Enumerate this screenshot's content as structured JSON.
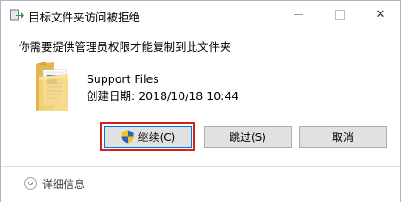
{
  "window": {
    "title": "目标文件夹访问被拒绝",
    "minimize_icon": "minimize-icon",
    "maximize_icon": "maximize-icon",
    "close_glyph": "✕"
  },
  "dialog": {
    "message": "你需要提供管理员权限才能复制到此文件夹",
    "item": {
      "icon": "folder-icon",
      "name": "Support Files",
      "created_label": "创建日期:",
      "created_value": "2018/10/18 10:44"
    }
  },
  "buttons": {
    "continue_label": "继续(C)",
    "continue_icon": "uac-shield-icon",
    "skip_label": "跳过(S)",
    "cancel_label": "取消"
  },
  "footer": {
    "details_label": "详细信息",
    "details_icon": "chevron-down-circle-icon"
  },
  "colors": {
    "highlight": "#d21f1f",
    "default_button_border": "#0078d7",
    "button_face": "#e1e1e1"
  }
}
